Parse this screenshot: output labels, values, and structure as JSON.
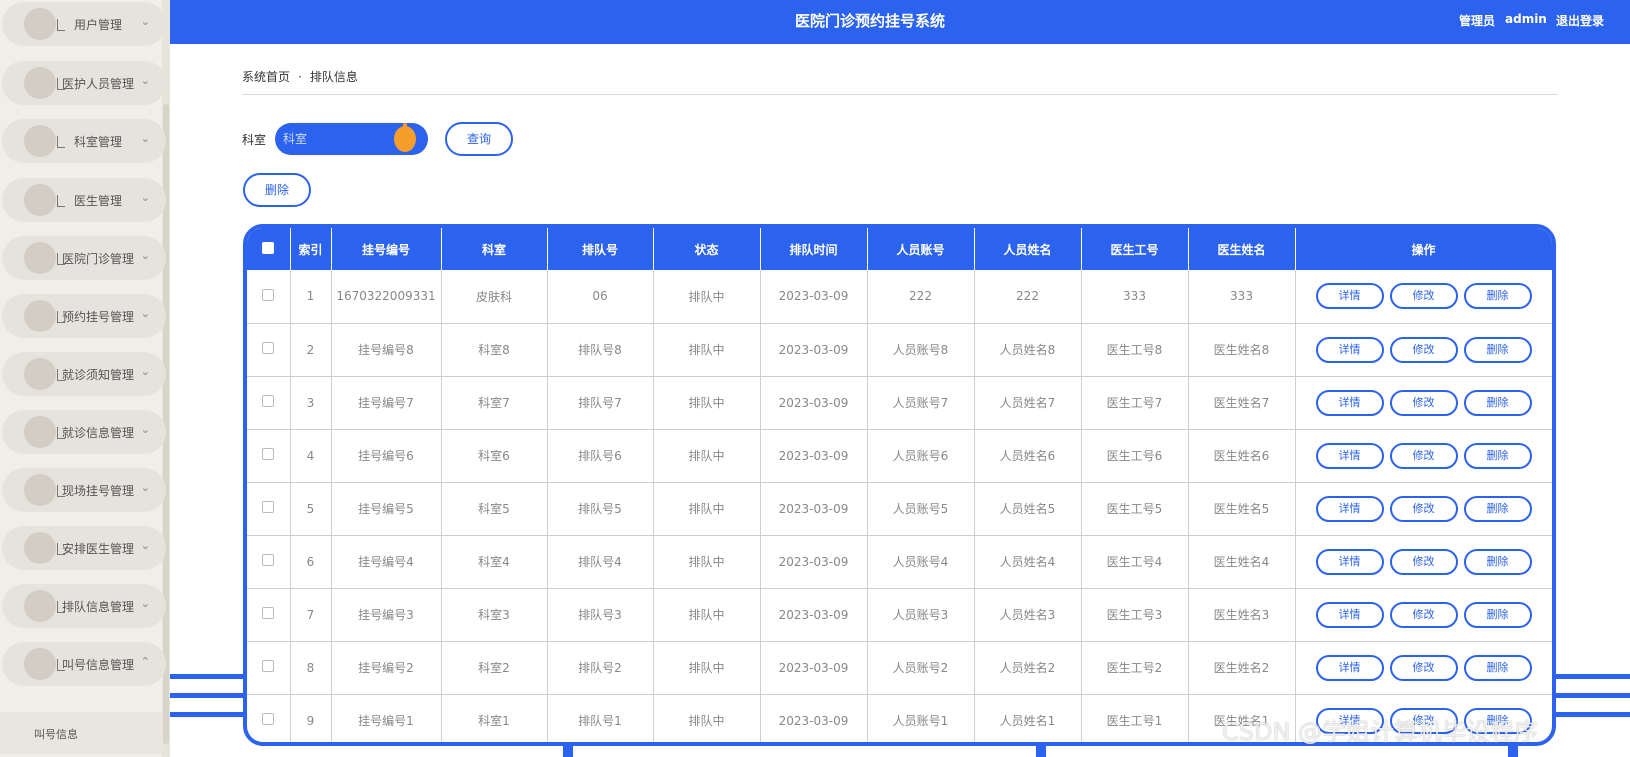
{
  "header": {
    "title": "医院门诊预约挂号系统",
    "role": "管理员",
    "username": "admin",
    "logout": "退出登录"
  },
  "sidebar": {
    "items": [
      {
        "label": "用户管理"
      },
      {
        "label": "医护人员管理"
      },
      {
        "label": "科室管理"
      },
      {
        "label": "医生管理"
      },
      {
        "label": "医院门诊管理"
      },
      {
        "label": "预约挂号管理"
      },
      {
        "label": "就诊须知管理"
      },
      {
        "label": "就诊信息管理"
      },
      {
        "label": "现场挂号管理"
      },
      {
        "label": "安排医生管理"
      },
      {
        "label": "排队信息管理"
      },
      {
        "label": "叫号信息管理"
      }
    ],
    "submenu": {
      "label": "叫号信息"
    },
    "arrow_collapsed": "⌄",
    "arrow_expanded": "⌃"
  },
  "breadcrumb": {
    "home": "系统首页",
    "separator": "·",
    "current": "排队信息"
  },
  "search": {
    "label": "科室",
    "placeholder": "科室",
    "button": "查询"
  },
  "toolbar": {
    "delete_label": "删除"
  },
  "table": {
    "columns": [
      "索引",
      "挂号编号",
      "科室",
      "排队号",
      "状态",
      "排队时间",
      "人员账号",
      "人员姓名",
      "医生工号",
      "医生姓名",
      "操作"
    ],
    "actions": {
      "detail": "详情",
      "edit": "修改",
      "delete": "删除"
    },
    "rows": [
      [
        "1",
        "1670322009331",
        "皮肤科",
        "06",
        "排队中",
        "2023-03-09",
        "222",
        "222",
        "333",
        "333"
      ],
      [
        "2",
        "挂号编号8",
        "科室8",
        "排队号8",
        "排队中",
        "2023-03-09",
        "人员账号8",
        "人员姓名8",
        "医生工号8",
        "医生姓名8"
      ],
      [
        "3",
        "挂号编号7",
        "科室7",
        "排队号7",
        "排队中",
        "2023-03-09",
        "人员账号7",
        "人员姓名7",
        "医生工号7",
        "医生姓名7"
      ],
      [
        "4",
        "挂号编号6",
        "科室6",
        "排队号6",
        "排队中",
        "2023-03-09",
        "人员账号6",
        "人员姓名6",
        "医生工号6",
        "医生姓名6"
      ],
      [
        "5",
        "挂号编号5",
        "科室5",
        "排队号5",
        "排队中",
        "2023-03-09",
        "人员账号5",
        "人员姓名5",
        "医生工号5",
        "医生姓名5"
      ],
      [
        "6",
        "挂号编号4",
        "科室4",
        "排队号4",
        "排队中",
        "2023-03-09",
        "人员账号4",
        "人员姓名4",
        "医生工号4",
        "医生姓名4"
      ],
      [
        "7",
        "挂号编号3",
        "科室3",
        "排队号3",
        "排队中",
        "2023-03-09",
        "人员账号3",
        "人员姓名3",
        "医生工号3",
        "医生姓名3"
      ],
      [
        "8",
        "挂号编号2",
        "科室2",
        "排队号2",
        "排队中",
        "2023-03-09",
        "人员账号2",
        "人员姓名2",
        "医生工号2",
        "医生姓名2"
      ],
      [
        "9",
        "挂号编号1",
        "科室1",
        "排队号1",
        "排队中",
        "2023-03-09",
        "人员账号1",
        "人员姓名1",
        "医生工号1",
        "医生姓名1"
      ]
    ]
  },
  "watermark": "CSDN @学姐计算机毕设程序",
  "colors": {
    "primary": "#2b62ee",
    "accent": "#f59e2a",
    "sidebar_bg": "#f0eee8"
  }
}
